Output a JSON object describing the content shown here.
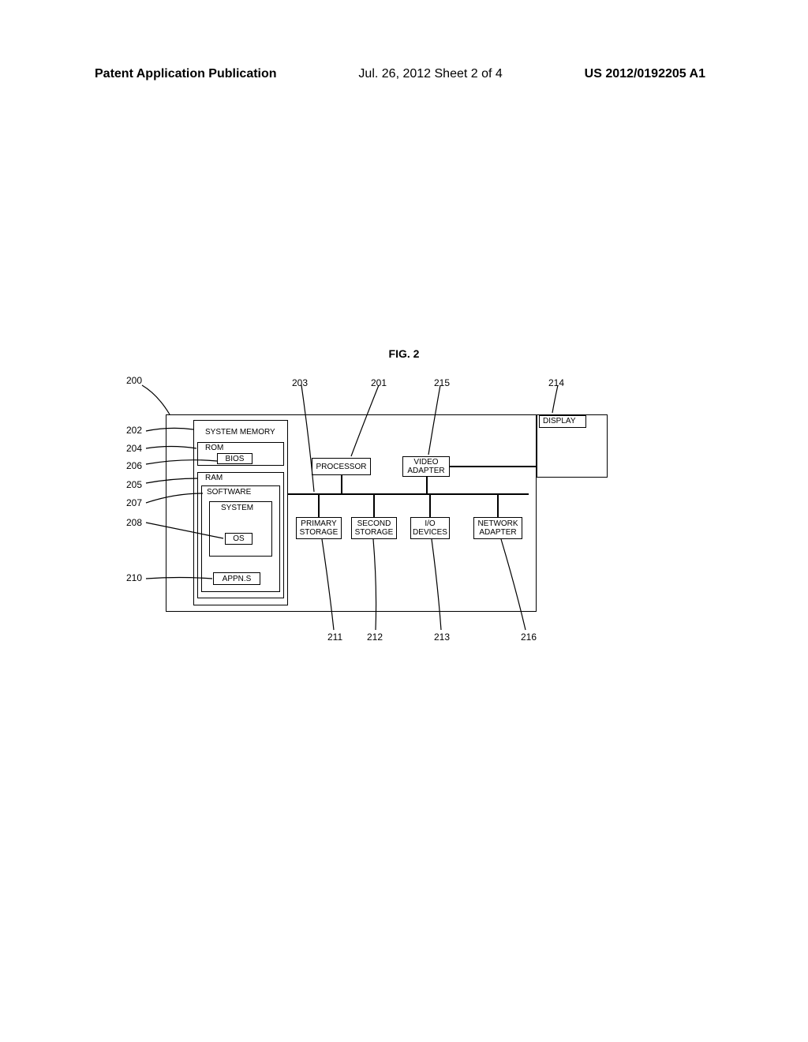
{
  "header": {
    "left": "Patent Application Publication",
    "mid": "Jul. 26, 2012  Sheet 2 of 4",
    "right": "US 2012/0192205 A1"
  },
  "figure_title": "FIG. 2",
  "boxes": {
    "system_memory": "SYSTEM MEMORY",
    "rom": "ROM",
    "bios": "BIOS",
    "ram": "RAM",
    "software": "SOFTWARE",
    "system": "SYSTEM",
    "os": "OS",
    "appns": "APPN.S",
    "processor": "PROCESSOR",
    "video_adapter": "VIDEO\nADAPTER",
    "primary_storage": "PRIMARY\nSTORAGE",
    "second_storage": "SECOND\nSTORAGE",
    "io_devices": "I/O\nDEVICES",
    "network_adapter": "NETWORK\nADAPTER",
    "display": "DISPLAY"
  },
  "refs": {
    "r200": "200",
    "r202": "202",
    "r204": "204",
    "r206": "206",
    "r205": "205",
    "r207": "207",
    "r208": "208",
    "r210": "210",
    "r203": "203",
    "r201": "201",
    "r215": "215",
    "r214": "214",
    "r211": "211",
    "r212": "212",
    "r213": "213",
    "r216": "216"
  }
}
